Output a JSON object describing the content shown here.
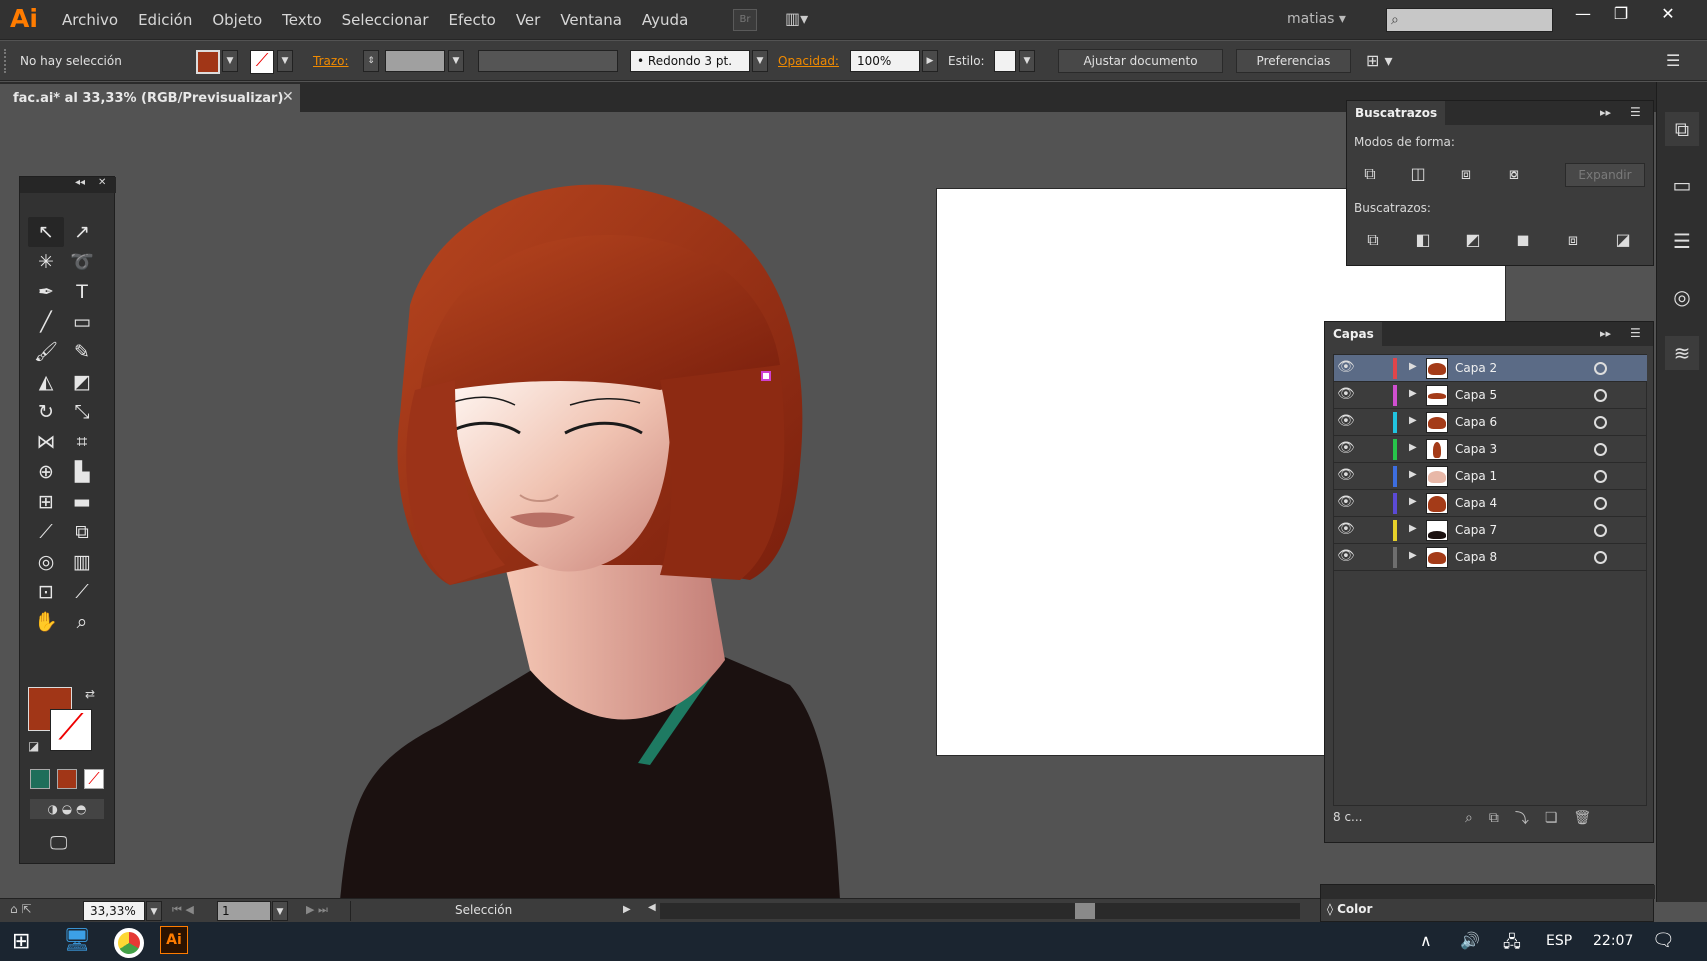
{
  "app": {
    "logo": "Ai",
    "user": "matias"
  },
  "menus": [
    "Archivo",
    "Edición",
    "Objeto",
    "Texto",
    "Seleccionar",
    "Efecto",
    "Ver",
    "Ventana",
    "Ayuda"
  ],
  "menubar_buttons": {
    "bridge": "Br"
  },
  "control": {
    "selection": "No hay selección",
    "stroke_label": "Trazo:",
    "brush": "Redondo 3 pt.",
    "opacity_label": "Opacidad:",
    "opacity": "100%",
    "style_label": "Estilo:",
    "fit_button": "Ajustar documento",
    "prefs_button": "Preferencias"
  },
  "document": {
    "tab_title": "fac.ai* al 33,33% (RGB/Previsualizar)"
  },
  "pathfinder": {
    "title": "Buscatrazos",
    "shape_modes": "Modos de forma:",
    "expand": "Expandir",
    "pathfinders": "Buscatrazos:"
  },
  "layers": {
    "title": "Capas",
    "count": "8 c...",
    "items": [
      {
        "name": "Capa 2",
        "color": "#e0454a",
        "selected": true
      },
      {
        "name": "Capa 5",
        "color": "#d04fd0"
      },
      {
        "name": "Capa 6",
        "color": "#21c4e0"
      },
      {
        "name": "Capa 3",
        "color": "#27c44a"
      },
      {
        "name": "Capa 1",
        "color": "#3d6ee0"
      },
      {
        "name": "Capa 4",
        "color": "#5b4ad6"
      },
      {
        "name": "Capa 7",
        "color": "#e6d12a"
      },
      {
        "name": "Capa 8",
        "color": "#6e6e6e"
      }
    ]
  },
  "color_panel": {
    "title": "Color"
  },
  "status": {
    "zoom": "33,33%",
    "page": "1",
    "tool": "Selección"
  },
  "taskbar": {
    "lang": "ESP",
    "time": "22:07"
  },
  "colors": {
    "fill": "#a13617",
    "accent_orange": "#ff7c00",
    "hair": "#a43618",
    "shirt": "#1b1110"
  }
}
